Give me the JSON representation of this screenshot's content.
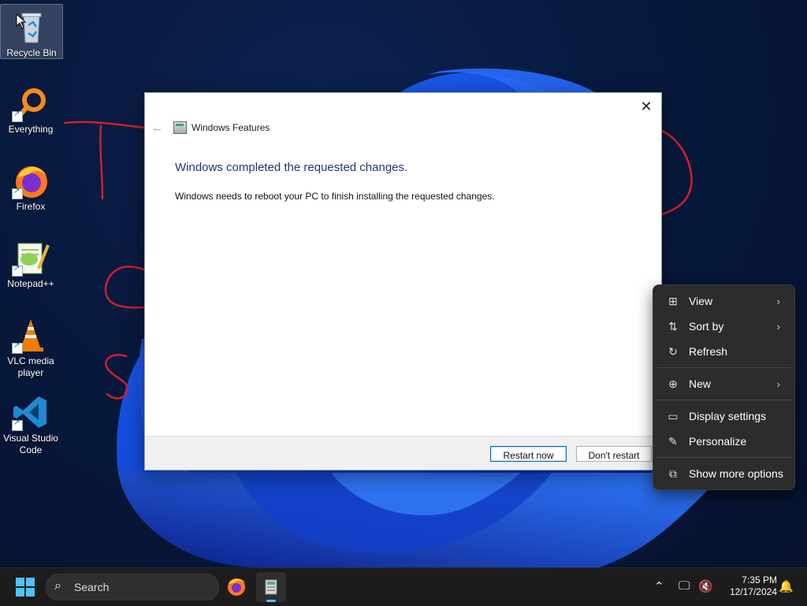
{
  "desktop": {
    "icons": [
      {
        "label": "Recycle Bin",
        "icon": "recycle-bin-icon"
      },
      {
        "label": "Everything",
        "icon": "everything-search-icon"
      },
      {
        "label": "Firefox",
        "icon": "firefox-icon"
      },
      {
        "label": "Notepad++",
        "icon": "notepad-plus-plus-icon"
      },
      {
        "label": "VLC media player",
        "icon": "vlc-cone-icon"
      },
      {
        "label": "Visual Studio Code",
        "icon": "vscode-icon"
      }
    ],
    "annotation_color": "#d0202a"
  },
  "dialog": {
    "title": "Windows Features",
    "heading": "Windows completed the requested changes.",
    "message": "Windows needs to reboot your PC to finish installing the requested changes.",
    "primary_button": "Restart now",
    "secondary_button": "Don't restart",
    "heading_color": "#1e3a78"
  },
  "context_menu": {
    "items": [
      {
        "label": "View",
        "icon": "grid-view-icon",
        "submenu": true
      },
      {
        "label": "Sort by",
        "icon": "sort-arrows-icon",
        "submenu": true
      },
      {
        "label": "Refresh",
        "icon": "refresh-icon",
        "submenu": false
      },
      {
        "label": "New",
        "icon": "plus-circle-icon",
        "submenu": true
      },
      {
        "label": "Display settings",
        "icon": "display-settings-icon",
        "submenu": false
      },
      {
        "label": "Personalize",
        "icon": "pen-icon",
        "submenu": false
      },
      {
        "label": "Show more options",
        "icon": "expand-options-icon",
        "submenu": false
      }
    ]
  },
  "taskbar": {
    "search_placeholder": "Search",
    "time": "7:35 PM",
    "date": "12/17/2024",
    "accent": "#4cc2ff"
  }
}
